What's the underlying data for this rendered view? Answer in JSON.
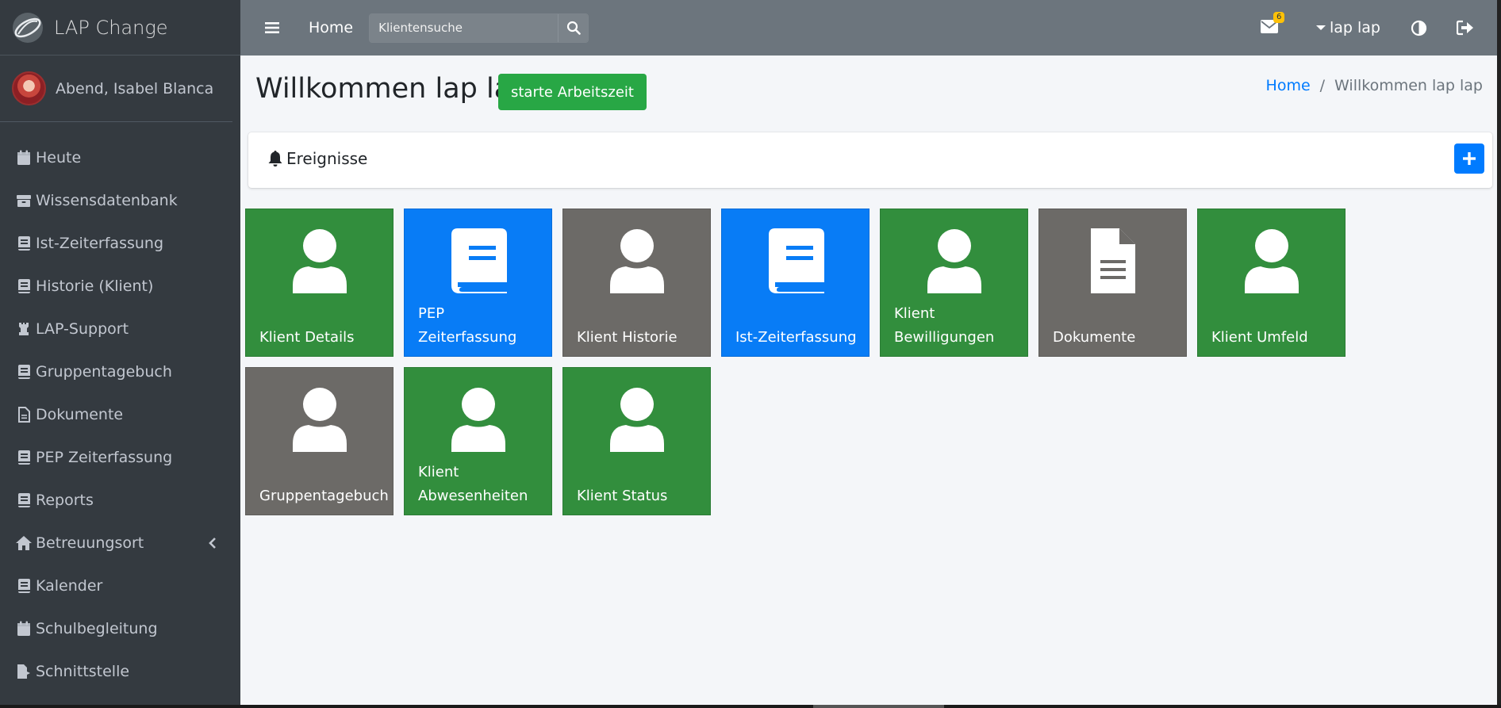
{
  "brand": {
    "name": "LAP Change"
  },
  "user_panel": {
    "name": "Abend, Isabel Blanca"
  },
  "sidebar": {
    "items": [
      {
        "label": "Heute",
        "icon": "calendar-icon"
      },
      {
        "label": "Wissensdatenbank",
        "icon": "archive-icon"
      },
      {
        "label": "Ist-Zeiterfassung",
        "icon": "book-icon"
      },
      {
        "label": "Historie (Klient)",
        "icon": "book-icon"
      },
      {
        "label": "LAP-Support",
        "icon": "chess-rook-icon"
      },
      {
        "label": "Gruppentagebuch",
        "icon": "book-icon"
      },
      {
        "label": "Dokumente",
        "icon": "file-icon"
      },
      {
        "label": "PEP Zeiterfassung",
        "icon": "book-icon"
      },
      {
        "label": "Reports",
        "icon": "book-icon"
      },
      {
        "label": "Betreuungsort",
        "icon": "home-icon"
      },
      {
        "label": "Kalender",
        "icon": "book-icon"
      },
      {
        "label": "Schulbegleitung",
        "icon": "calendar-icon"
      },
      {
        "label": "Schnittstelle",
        "icon": "file-export-icon"
      }
    ]
  },
  "topbar": {
    "home_label": "Home",
    "search_placeholder": "Klientensuche",
    "mail_count": "6",
    "user_label": "lap lap"
  },
  "header": {
    "title": "Willkommen lap lap",
    "start_button": "starte Arbeitszeit"
  },
  "breadcrumb": {
    "home": "Home",
    "separator": "/",
    "current": "Willkommen lap lap"
  },
  "events": {
    "title": "Ereignisse"
  },
  "tiles": [
    {
      "label": "Klient Details",
      "color": "#328e3d",
      "icon": "user-icon"
    },
    {
      "label": "PEP Zeiterfassung",
      "color": "#087cf6",
      "icon": "book-icon"
    },
    {
      "label": "Klient Historie",
      "color": "#6c6a67",
      "icon": "user-icon"
    },
    {
      "label": "Ist-Zeiterfassung",
      "color": "#087cf6",
      "icon": "book-icon"
    },
    {
      "label": "Klient Bewilligungen",
      "color": "#328e3d",
      "icon": "user-icon"
    },
    {
      "label": "Dokumente",
      "color": "#6c6a67",
      "icon": "file-icon"
    },
    {
      "label": "Klient Umfeld",
      "color": "#328e3d",
      "icon": "user-icon"
    },
    {
      "label": "Gruppentagebuch",
      "color": "#6c6a67",
      "icon": "user-icon"
    },
    {
      "label": "Klient Abwesenheiten",
      "color": "#328e3d",
      "icon": "user-icon"
    },
    {
      "label": "Klient Status",
      "color": "#328e3d",
      "icon": "user-icon"
    }
  ],
  "colors": {
    "sidebar_bg": "#343a40",
    "topbar_bg": "#6c757d",
    "content_bg": "#f4f6f9",
    "success": "#28a745",
    "primary": "#007bff",
    "badge": "#ffc107"
  }
}
